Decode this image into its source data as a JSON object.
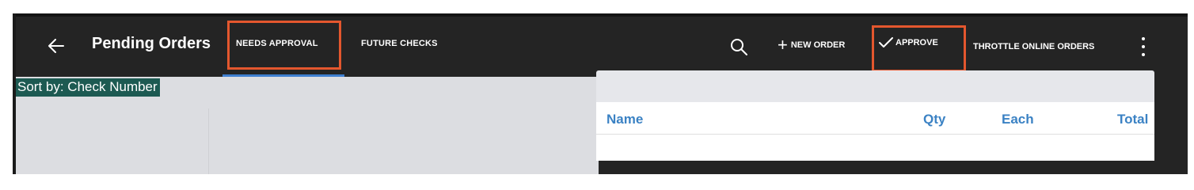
{
  "header": {
    "title": "Pending Orders",
    "back_icon": "arrow-left-icon"
  },
  "tabs": [
    {
      "label": "NEEDS APPROVAL",
      "active": true
    },
    {
      "label": "FUTURE CHECKS",
      "active": false
    }
  ],
  "actions": {
    "search_icon": "search-icon",
    "new_order": {
      "icon": "plus-icon",
      "label": "NEW ORDER"
    },
    "approve": {
      "icon": "checkmark-icon",
      "label": "APPROVE"
    },
    "throttle": {
      "label": "THROTTLE ONLINE ORDERS"
    },
    "more_icon": "more-vertical-icon"
  },
  "sort": {
    "label": "Sort by: Check Number"
  },
  "order_table": {
    "columns": [
      "Name",
      "Qty",
      "Each",
      "Total"
    ]
  },
  "colors": {
    "topbar": "#242424",
    "accent": "#3f7fd0",
    "highlight": "#e4572e",
    "sort_bg": "#1d5a52",
    "column_header": "#3b82c4"
  }
}
